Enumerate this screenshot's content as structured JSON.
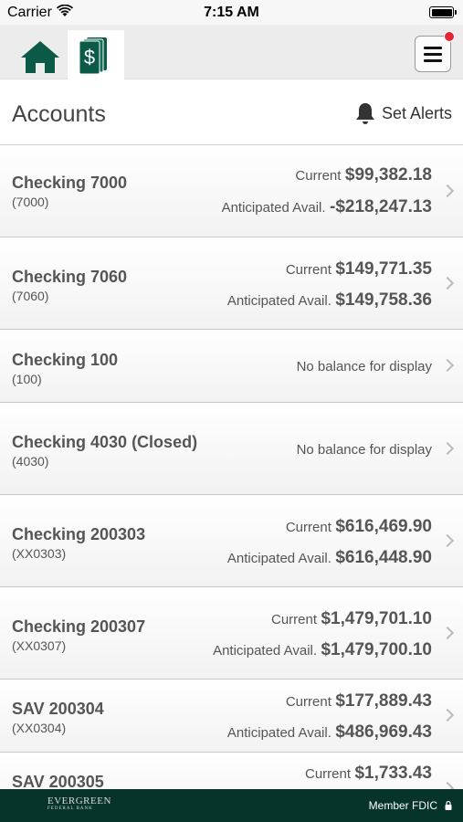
{
  "status_bar": {
    "carrier": "Carrier",
    "time": "7:15 AM"
  },
  "nav": {
    "home_icon": "home-icon",
    "accounts_icon": "money-stack-icon",
    "menu_icon": "hamburger-menu-icon",
    "accent": "#0b5a47"
  },
  "header": {
    "title": "Accounts",
    "set_alerts": "Set Alerts"
  },
  "accounts": [
    {
      "name": "Checking 7000",
      "number": "(7000)",
      "current_label": "Current",
      "current": "$99,382.18",
      "anticipated_label": "Anticipated Avail.",
      "anticipated": "-$218,247.13"
    },
    {
      "name": "Checking 7060",
      "number": "(7060)",
      "current_label": "Current",
      "current": "$149,771.35",
      "anticipated_label": "Anticipated Avail.",
      "anticipated": "$149,758.36"
    },
    {
      "name": "Checking 100",
      "number": "(100)",
      "no_balance": "No balance for display"
    },
    {
      "name": "Checking 4030 (Closed)",
      "number": "(4030)",
      "no_balance": "No balance for display"
    },
    {
      "name": "Checking 200303",
      "number": "(XX0303)",
      "current_label": "Current",
      "current": "$616,469.90",
      "anticipated_label": "Anticipated Avail.",
      "anticipated": "$616,448.90"
    },
    {
      "name": "Checking 200307",
      "number": "(XX0307)",
      "current_label": "Current",
      "current": "$1,479,701.10",
      "anticipated_label": "Anticipated Avail.",
      "anticipated": "$1,479,700.10"
    },
    {
      "name": "SAV 200304",
      "number": "(XX0304)",
      "current_label": "Current",
      "current": "$177,889.43",
      "anticipated_label": "Anticipated Avail.",
      "anticipated": "$486,969.43"
    },
    {
      "name": "SAV 200305",
      "number": "",
      "current_label": "Current",
      "current": "$1,733.43"
    }
  ],
  "footer": {
    "logo_text": "EVERGREEN",
    "logo_subtext": "FEDERAL BANK",
    "member_fdic": "Member FDIC",
    "background": "#06332a"
  }
}
